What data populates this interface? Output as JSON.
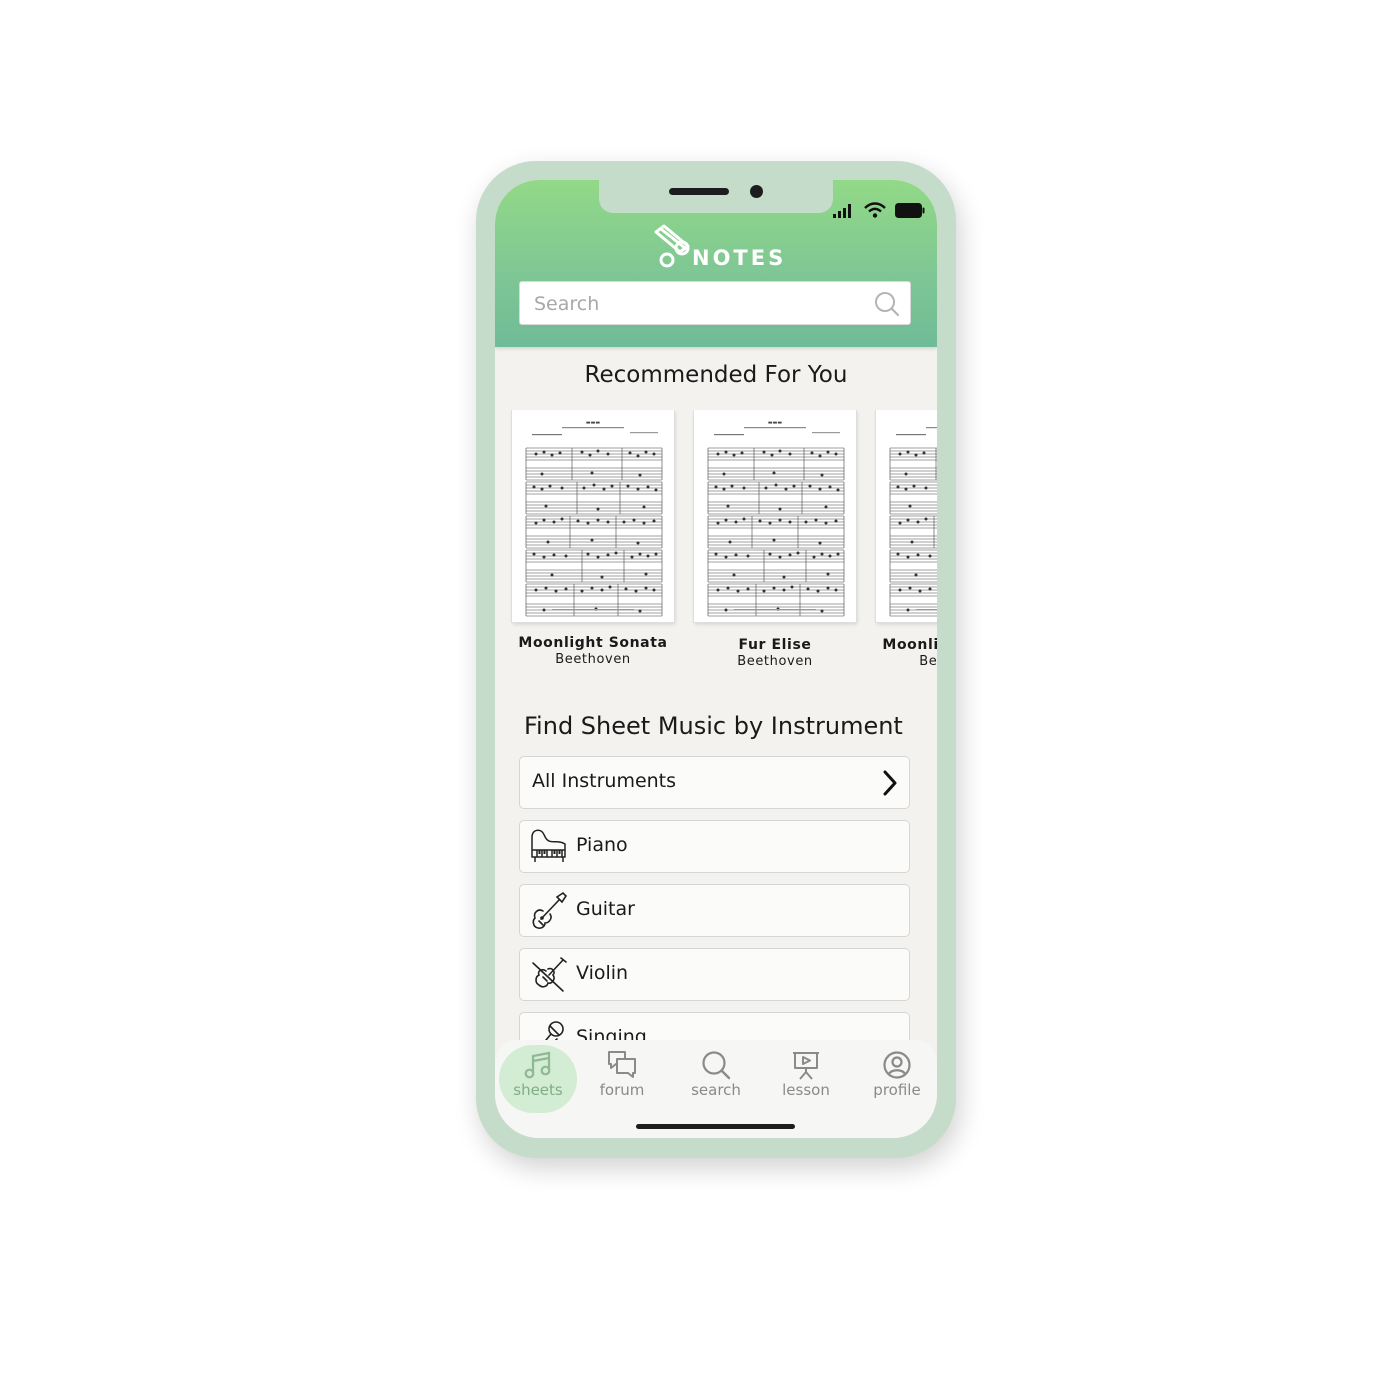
{
  "app": {
    "logo_text": "NOTES",
    "search_placeholder": "Search"
  },
  "recommended": {
    "title": "Recommended For You",
    "items": [
      {
        "title": "Moonlight Sonata",
        "composer": "Beethoven"
      },
      {
        "title": "Fur Elise",
        "composer": "Beethoven"
      },
      {
        "title": "Moonlight Sonata",
        "composer": "Beethoven"
      }
    ]
  },
  "instruments": {
    "title": "Find Sheet Music by Instrument",
    "all_label": "All Instruments",
    "items": [
      {
        "label": "Piano",
        "icon": "piano-icon"
      },
      {
        "label": "Guitar",
        "icon": "guitar-icon"
      },
      {
        "label": "Violin",
        "icon": "violin-icon"
      },
      {
        "label": "Singing",
        "icon": "microphone-icon"
      }
    ]
  },
  "tabbar": {
    "active": "sheets",
    "tabs": [
      {
        "label": "sheets",
        "icon": "music-note-icon"
      },
      {
        "label": "forum",
        "icon": "chat-bubbles-icon"
      },
      {
        "label": "search",
        "icon": "search-icon"
      },
      {
        "label": "lesson",
        "icon": "presentation-board-icon"
      },
      {
        "label": "profile",
        "icon": "user-circle-icon"
      }
    ]
  },
  "colors": {
    "header_top": "#92d987",
    "header_bottom": "#70bb98",
    "phone_frame": "#c6dccb",
    "active_tab_bg": "#d3ecd4",
    "active_tab_text": "#7fae85"
  }
}
